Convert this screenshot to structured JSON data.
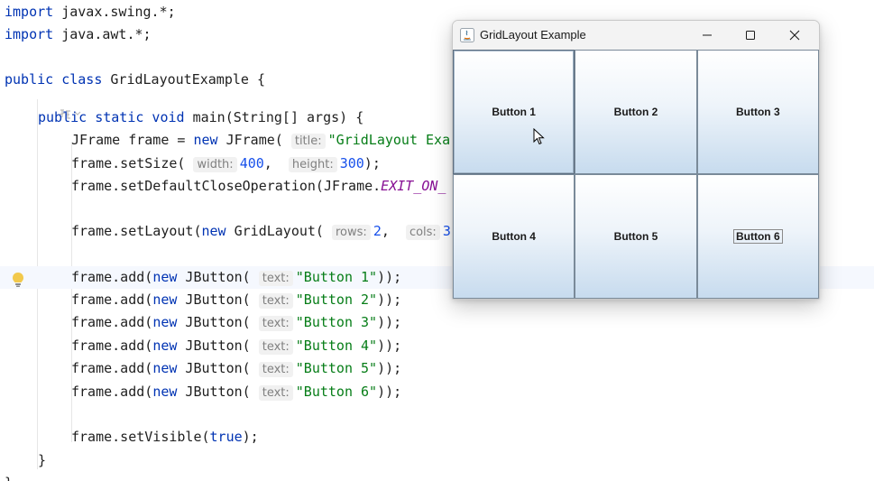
{
  "editor": {
    "lines": [
      {
        "id": "l1",
        "segments": [
          {
            "t": "import",
            "c": "kw"
          },
          {
            "t": " javax.swing.*;",
            "c": ""
          }
        ]
      },
      {
        "id": "l2",
        "segments": [
          {
            "t": "import",
            "c": "kw"
          },
          {
            "t": " java.awt.*;",
            "c": ""
          }
        ]
      },
      {
        "id": "l3",
        "segments": [
          {
            "t": "public class",
            "c": "kw"
          },
          {
            "t": " GridLayoutExample {",
            "c": ""
          }
        ]
      },
      {
        "id": "l4",
        "segments": [
          {
            "t": "public static void",
            "c": "kw"
          },
          {
            "t": " main(String[] args) {",
            "c": ""
          }
        ]
      },
      {
        "id": "l5",
        "segments": [
          {
            "t": "JFrame frame = ",
            "c": ""
          },
          {
            "t": "new",
            "c": "kw"
          },
          {
            "t": " JFrame( ",
            "c": ""
          },
          {
            "t": "title:",
            "c": "hint"
          },
          {
            "t": "\"GridLayout Exa",
            "c": "str"
          }
        ]
      },
      {
        "id": "l6",
        "segments": [
          {
            "t": "frame.setSize( ",
            "c": ""
          },
          {
            "t": "width:",
            "c": "hint"
          },
          {
            "t": "400",
            "c": "num"
          },
          {
            "t": ",  ",
            "c": ""
          },
          {
            "t": "height:",
            "c": "hint"
          },
          {
            "t": "300",
            "c": "num"
          },
          {
            "t": ");",
            "c": ""
          }
        ]
      },
      {
        "id": "l7",
        "segments": [
          {
            "t": "frame.setDefaultCloseOperation(JFrame.",
            "c": ""
          },
          {
            "t": "EXIT_ON_",
            "c": "const"
          }
        ]
      },
      {
        "id": "l8",
        "segments": [
          {
            "t": "frame.setLayout(",
            "c": ""
          },
          {
            "t": "new",
            "c": "kw"
          },
          {
            "t": " GridLayout( ",
            "c": ""
          },
          {
            "t": "rows:",
            "c": "hint"
          },
          {
            "t": "2",
            "c": "num"
          },
          {
            "t": ",  ",
            "c": ""
          },
          {
            "t": "cols:",
            "c": "hint"
          },
          {
            "t": "3",
            "c": "num"
          },
          {
            "t": ")",
            "c": ""
          }
        ]
      },
      {
        "id": "l9",
        "segments": [
          {
            "t": "frame.add(",
            "c": ""
          },
          {
            "t": "new",
            "c": "kw"
          },
          {
            "t": " JButton( ",
            "c": ""
          },
          {
            "t": "text:",
            "c": "hint"
          },
          {
            "t": "\"Button 1\"",
            "c": "str"
          },
          {
            "t": "));",
            "c": ""
          }
        ]
      },
      {
        "id": "l10",
        "segments": [
          {
            "t": "frame.add(",
            "c": ""
          },
          {
            "t": "new",
            "c": "kw"
          },
          {
            "t": " JButton( ",
            "c": ""
          },
          {
            "t": "text:",
            "c": "hint"
          },
          {
            "t": "\"Button 2\"",
            "c": "str"
          },
          {
            "t": "));",
            "c": ""
          }
        ]
      },
      {
        "id": "l11",
        "segments": [
          {
            "t": "frame.add(",
            "c": ""
          },
          {
            "t": "new",
            "c": "kw"
          },
          {
            "t": " JButton( ",
            "c": ""
          },
          {
            "t": "text:",
            "c": "hint"
          },
          {
            "t": "\"Button 3\"",
            "c": "str"
          },
          {
            "t": "));",
            "c": ""
          }
        ]
      },
      {
        "id": "l12",
        "segments": [
          {
            "t": "frame.add(",
            "c": ""
          },
          {
            "t": "new",
            "c": "kw"
          },
          {
            "t": " JButton( ",
            "c": ""
          },
          {
            "t": "text:",
            "c": "hint"
          },
          {
            "t": "\"Button 4\"",
            "c": "str"
          },
          {
            "t": "));",
            "c": ""
          }
        ]
      },
      {
        "id": "l13",
        "segments": [
          {
            "t": "frame.add(",
            "c": ""
          },
          {
            "t": "new",
            "c": "kw"
          },
          {
            "t": " JButton( ",
            "c": ""
          },
          {
            "t": "text:",
            "c": "hint"
          },
          {
            "t": "\"Button 5\"",
            "c": "str"
          },
          {
            "t": "));",
            "c": ""
          }
        ]
      },
      {
        "id": "l14",
        "segments": [
          {
            "t": "frame.add(",
            "c": ""
          },
          {
            "t": "new",
            "c": "kw"
          },
          {
            "t": " JButton( ",
            "c": ""
          },
          {
            "t": "text:",
            "c": "hint"
          },
          {
            "t": "\"Button 6\"",
            "c": "str"
          },
          {
            "t": "));",
            "c": ""
          }
        ]
      },
      {
        "id": "l15",
        "segments": [
          {
            "t": "frame.setVisible(",
            "c": ""
          },
          {
            "t": "true",
            "c": "kw"
          },
          {
            "t": ");",
            "c": ""
          }
        ]
      },
      {
        "id": "l16",
        "segments": [
          {
            "t": "}",
            "c": ""
          }
        ]
      },
      {
        "id": "l17",
        "segments": [
          {
            "t": "}",
            "c": ""
          }
        ]
      }
    ],
    "ai_hint_icon": "ai-assistant-icon",
    "intention_icon": "lightbulb-icon"
  },
  "swing_window": {
    "title": "GridLayout Example",
    "app_icon": "java-icon",
    "controls": {
      "minimize": "minimize-icon",
      "maximize": "maximize-icon",
      "close": "close-icon"
    },
    "buttons": [
      {
        "label": "Button 1"
      },
      {
        "label": "Button 2"
      },
      {
        "label": "Button 3"
      },
      {
        "label": "Button 4"
      },
      {
        "label": "Button 5"
      },
      {
        "label": "Button 6"
      }
    ]
  },
  "colors": {
    "keyword": "#0033b3",
    "string": "#067d17",
    "number": "#1750eb",
    "constant": "#871094",
    "button_gradient_bottom": "#c7dbee",
    "lightbulb": "#f2c94c"
  }
}
